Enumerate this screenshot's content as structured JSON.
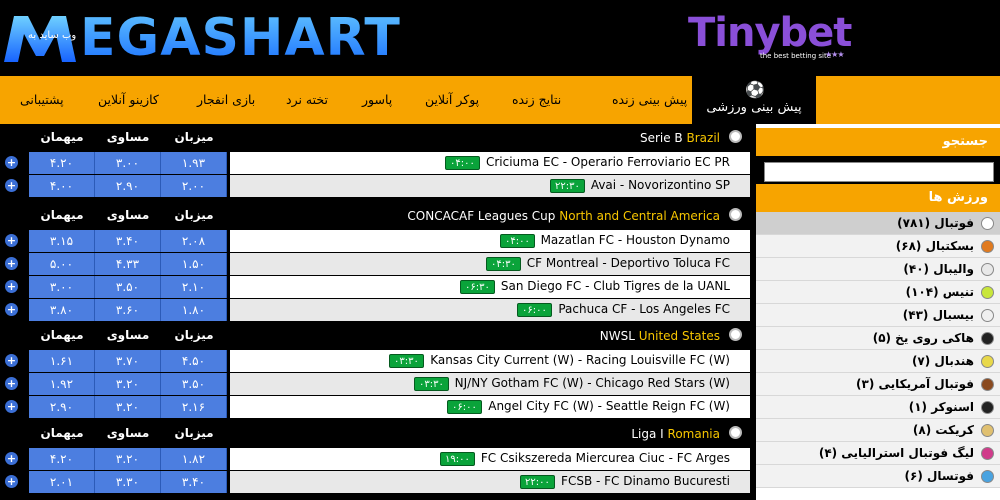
{
  "header": {
    "logo_text": "EGASHART",
    "logo_subtitle": "وب ساید به",
    "partner_logo": "Tinybet",
    "partner_tagline": "the best betting site",
    "partner_stars": "★★★"
  },
  "nav": {
    "active": "پیش بینی ورزشی",
    "items": [
      "پیش بینی زنده",
      "نتایج زنده",
      "پوکر آنلاین",
      "پاسور",
      "تخته نرد",
      "بازی انفجار",
      "کازینو آنلاین",
      "پشتیبانی"
    ]
  },
  "columns": {
    "home": "میزبان",
    "draw": "مساوی",
    "away": "میهمان"
  },
  "sections": [
    {
      "league": "Serie B",
      "country": "Brazil",
      "rows": [
        {
          "teams": "Criciuma EC  -  Operario Ferroviario EC PR",
          "time": "۰۴:۰۰",
          "home": "۱.۹۳",
          "draw": "۳.۰۰",
          "away": "۴.۲۰"
        },
        {
          "teams": "Avai  -  Novorizontino SP",
          "time": "۲۲:۳۰",
          "home": "۲.۰۰",
          "draw": "۲.۹۰",
          "away": "۴.۰۰"
        }
      ]
    },
    {
      "league": "CONCACAF Leagues Cup",
      "country": "North and Central America",
      "rows": [
        {
          "teams": "Mazatlan FC  -  Houston Dynamo",
          "time": "۰۴:۰۰",
          "home": "۲.۰۸",
          "draw": "۳.۴۰",
          "away": "۳.۱۵"
        },
        {
          "teams": "CF Montreal  -  Deportivo Toluca FC",
          "time": "۰۴:۳۰",
          "home": "۱.۵۰",
          "draw": "۴.۳۳",
          "away": "۵.۰۰"
        },
        {
          "teams": "San Diego FC  -  Club Tigres de la UANL",
          "time": "۰۶:۳۰",
          "home": "۲.۱۰",
          "draw": "۳.۵۰",
          "away": "۳.۰۰"
        },
        {
          "teams": "Pachuca CF  -  Los Angeles FC",
          "time": "۰۶:۰۰",
          "home": "۱.۸۰",
          "draw": "۳.۶۰",
          "away": "۳.۸۰"
        }
      ]
    },
    {
      "league": "NWSL",
      "country": "United States",
      "rows": [
        {
          "teams": "Kansas City Current (W)  -  Racing Louisville FC (W)",
          "time": "۰۳:۳۰",
          "home": "۴.۵۰",
          "draw": "۳.۷۰",
          "away": "۱.۶۱"
        },
        {
          "teams": "NJ/NY Gotham FC (W)  -  Chicago Red Stars (W)",
          "time": "۰۳:۳۰",
          "home": "۳.۵۰",
          "draw": "۳.۲۰",
          "away": "۱.۹۲"
        },
        {
          "teams": "Angel City FC (W)  -  Seattle Reign FC (W)",
          "time": "۰۶:۰۰",
          "home": "۲.۱۶",
          "draw": "۳.۲۰",
          "away": "۲.۹۰"
        }
      ]
    },
    {
      "league": "Liga I",
      "country": "Romania",
      "rows": [
        {
          "teams": "FC Csikszereda Miercurea Ciuc  -  FC Arges",
          "time": "۱۹:۰۰",
          "home": "۱.۸۲",
          "draw": "۳.۲۰",
          "away": "۴.۲۰"
        },
        {
          "teams": "FCSB  -  FC Dinamo Bucuresti",
          "time": "۲۲:۰۰",
          "home": "۳.۴۰",
          "draw": "۳.۳۰",
          "away": "۲.۰۱"
        }
      ]
    }
  ],
  "sidebar": {
    "search_title": "جستجو",
    "search_placeholder": "",
    "sports_title": "ورزش ها",
    "sports": [
      {
        "label": "فوتبال (۷۸۱)",
        "icon": "soccer-icon",
        "color": "#ffffff"
      },
      {
        "label": "بسکتبال (۶۸)",
        "icon": "basketball-icon",
        "color": "#e07a1f"
      },
      {
        "label": "والیبال (۴۰)",
        "icon": "volleyball-icon",
        "color": "#e8e8e8"
      },
      {
        "label": "تنیس (۱۰۴)",
        "icon": "tennis-icon",
        "color": "#c8e63a"
      },
      {
        "label": "بیسبال (۴۳)",
        "icon": "baseball-icon",
        "color": "#f0f0f0"
      },
      {
        "label": "هاکی روی یخ (۵)",
        "icon": "hockey-puck-icon",
        "color": "#222222"
      },
      {
        "label": "هندبال (۷)",
        "icon": "handball-icon",
        "color": "#e8d84a"
      },
      {
        "label": "فوتبال آمریکایی (۳)",
        "icon": "american-football-icon",
        "color": "#8a4a1f"
      },
      {
        "label": "اسنوکر (۱)",
        "icon": "snooker-icon",
        "color": "#222222"
      },
      {
        "label": "کریکت (۸)",
        "icon": "cricket-icon",
        "color": "#e0c070"
      },
      {
        "label": "لیگ فوتبال استرالیایی (۴)",
        "icon": "aussie-rules-icon",
        "color": "#d03a8a"
      },
      {
        "label": "فوتسال (۶)",
        "icon": "futsal-icon",
        "color": "#4aa3e0"
      }
    ]
  }
}
